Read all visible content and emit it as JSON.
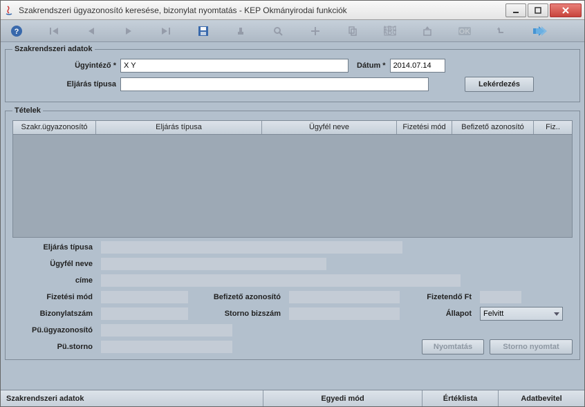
{
  "window": {
    "title": "Szakrendszeri ügyazonosító keresése, bizonylat nyomtatás - KEP Okmányirodai funkciók"
  },
  "szakr": {
    "legend": "Szakrendszeri adatok",
    "ugyintezo_label": "Ügyintéző *",
    "ugyintezo_value": "X Y",
    "datum_label": "Dátum *",
    "datum_value": "2014.07.14",
    "eljaras_label": "Eljárás típusa",
    "eljaras_value": "",
    "lekerdezes_label": "Lekérdezés"
  },
  "tetelek": {
    "legend": "Tételek",
    "cols": {
      "c0": "Szakr.ügyazonosító",
      "c1": "Eljárás típusa",
      "c2": "Ügyfél neve",
      "c3": "Fizetési mód",
      "c4": "Befizető azonosító",
      "c5": "Fiz.."
    }
  },
  "details": {
    "eljaras_label": "Eljárás típusa",
    "ugyfel_label": "Ügyfél neve",
    "cime_label": "címe",
    "fizmod_label": "Fizetési mód",
    "befazon_label": "Befizető azonosító",
    "fizft_label": "Fizetendő Ft",
    "bizszam_label": "Bizonylatszám",
    "storno_label": "Storno bizszám",
    "allapot_label": "Állapot",
    "allapot_value": "Felvitt",
    "puugy_label": "Pü.ügyazonosító",
    "pustorno_label": "Pü.storno",
    "nyomtatas_label": "Nyomtatás",
    "stornonyomtat_label": "Storno nyomtat"
  },
  "status": {
    "s0": "Szakrendszeri adatok",
    "s1": "Egyedi mód",
    "s2": "Értéklista",
    "s3": "Adatbevitel"
  }
}
